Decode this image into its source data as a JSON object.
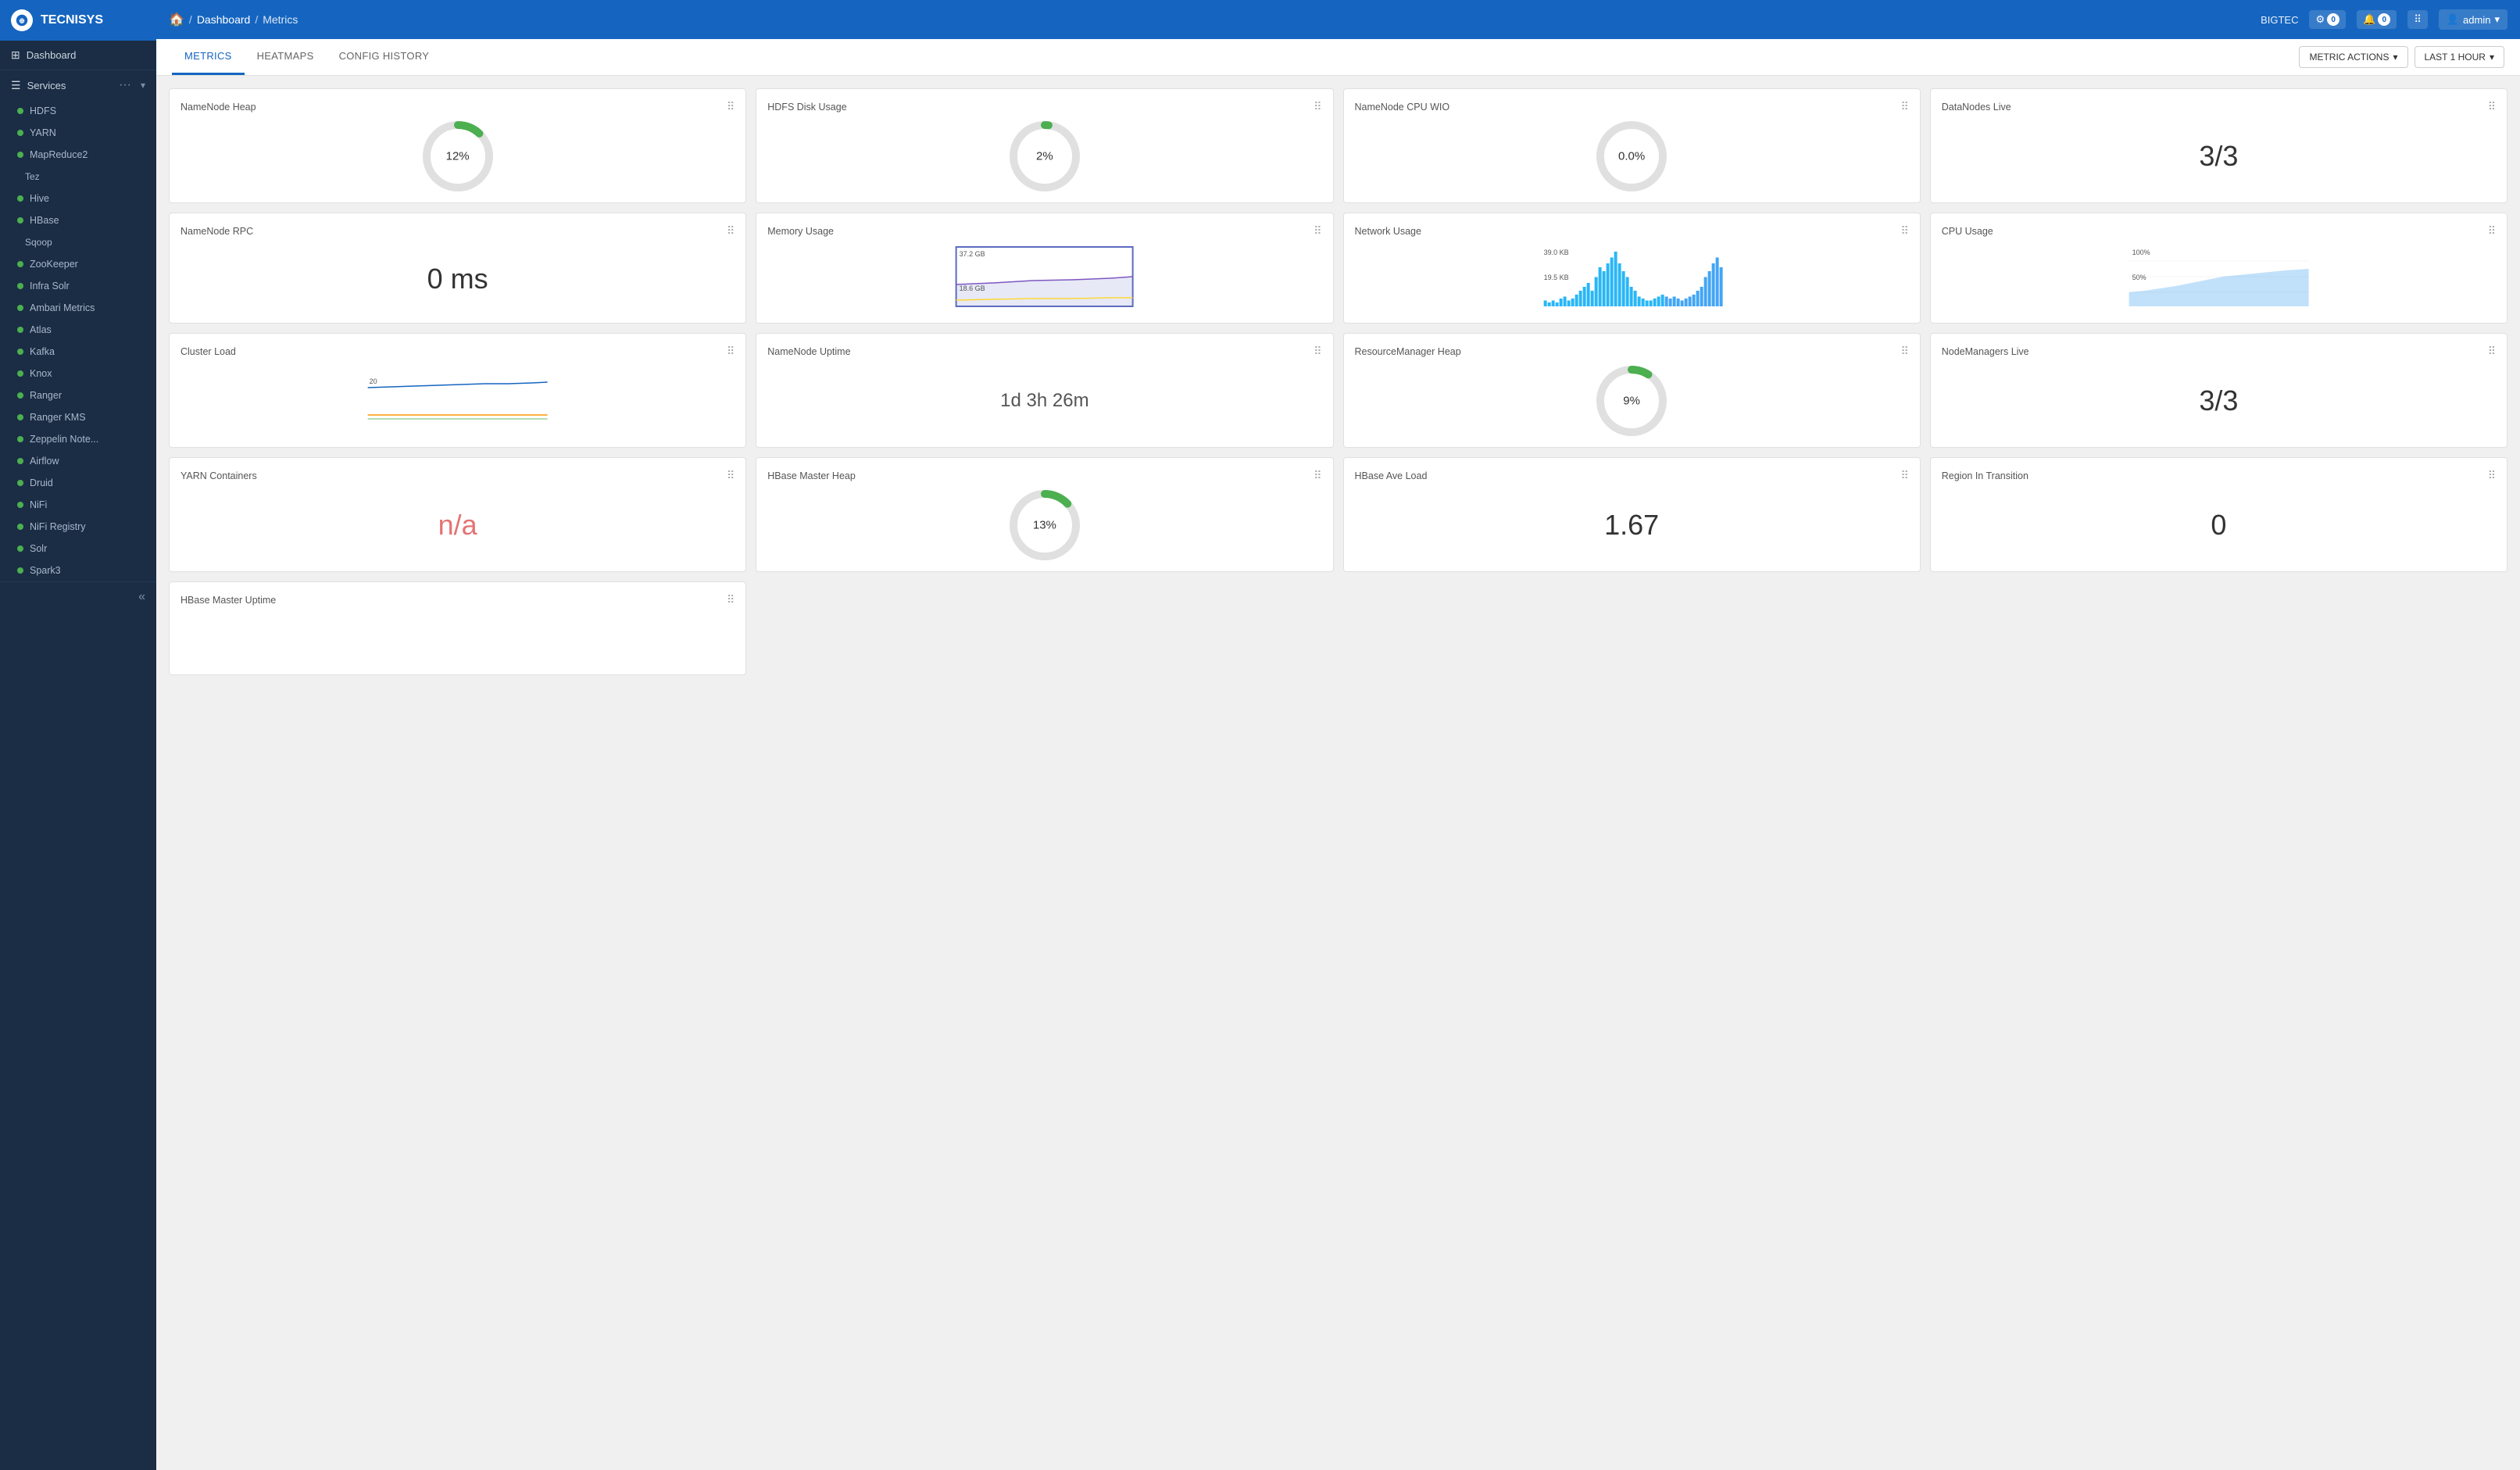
{
  "app": {
    "name": "TECNISYS",
    "cluster": "BIGTEC"
  },
  "topbar": {
    "home_icon": "🏠",
    "breadcrumb_sep": "/",
    "breadcrumb_page": "Dashboard",
    "breadcrumb_sub": "Metrics",
    "settings_badge": "0",
    "alerts_badge": "0",
    "admin_label": "admin"
  },
  "tabs": [
    {
      "id": "metrics",
      "label": "METRICS",
      "active": true
    },
    {
      "id": "heatmaps",
      "label": "HEATMAPS",
      "active": false
    },
    {
      "id": "config-history",
      "label": "CONFIG HISTORY",
      "active": false
    }
  ],
  "tab_actions": {
    "metric_actions": "METRIC ACTIONS",
    "time_range": "LAST 1 HOUR"
  },
  "sidebar": {
    "dashboard_label": "Dashboard",
    "services_label": "Services",
    "nav_items": [
      {
        "id": "hdfs",
        "label": "HDFS",
        "color": "#4caf50",
        "sub": false
      },
      {
        "id": "yarn",
        "label": "YARN",
        "color": "#4caf50",
        "sub": false
      },
      {
        "id": "mapreduce2",
        "label": "MapReduce2",
        "color": "#4caf50",
        "sub": false
      },
      {
        "id": "tez",
        "label": "Tez",
        "color": null,
        "sub": true
      },
      {
        "id": "hive",
        "label": "Hive",
        "color": "#4caf50",
        "sub": false
      },
      {
        "id": "hbase",
        "label": "HBase",
        "color": "#4caf50",
        "sub": false
      },
      {
        "id": "sqoop",
        "label": "Sqoop",
        "color": null,
        "sub": true
      },
      {
        "id": "zookeeper",
        "label": "ZooKeeper",
        "color": "#4caf50",
        "sub": false
      },
      {
        "id": "infra-solr",
        "label": "Infra Solr",
        "color": "#4caf50",
        "sub": false
      },
      {
        "id": "ambari-metrics",
        "label": "Ambari Metrics",
        "color": "#4caf50",
        "sub": false
      },
      {
        "id": "atlas",
        "label": "Atlas",
        "color": "#4caf50",
        "sub": false
      },
      {
        "id": "kafka",
        "label": "Kafka",
        "color": "#4caf50",
        "sub": false
      },
      {
        "id": "knox",
        "label": "Knox",
        "color": "#4caf50",
        "sub": false
      },
      {
        "id": "ranger",
        "label": "Ranger",
        "color": "#4caf50",
        "sub": false
      },
      {
        "id": "ranger-kms",
        "label": "Ranger KMS",
        "color": "#4caf50",
        "sub": false
      },
      {
        "id": "zeppelin",
        "label": "Zeppelin Note...",
        "color": "#4caf50",
        "sub": false
      },
      {
        "id": "airflow",
        "label": "Airflow",
        "color": "#4caf50",
        "sub": false
      },
      {
        "id": "druid",
        "label": "Druid",
        "color": "#4caf50",
        "sub": false
      },
      {
        "id": "nifi",
        "label": "NiFi",
        "color": "#4caf50",
        "sub": false
      },
      {
        "id": "nifi-registry",
        "label": "NiFi Registry",
        "color": "#4caf50",
        "sub": false
      },
      {
        "id": "solr",
        "label": "Solr",
        "color": "#4caf50",
        "sub": false
      },
      {
        "id": "spark3",
        "label": "Spark3",
        "color": "#4caf50",
        "sub": false
      }
    ]
  },
  "metrics": [
    {
      "id": "namenode-heap",
      "title": "NameNode Heap",
      "type": "donut",
      "value": "12%",
      "percent": 12,
      "color": "#4caf50",
      "track_color": "#e0e0e0"
    },
    {
      "id": "hdfs-disk-usage",
      "title": "HDFS Disk Usage",
      "type": "donut",
      "value": "2%",
      "percent": 2,
      "color": "#4caf50",
      "track_color": "#e0e0e0"
    },
    {
      "id": "namenode-cpu-wio",
      "title": "NameNode CPU WIO",
      "type": "donut",
      "value": "0.0%",
      "percent": 0,
      "color": "#e0e0e0",
      "track_color": "#e0e0e0"
    },
    {
      "id": "datanodes-live",
      "title": "DataNodes Live",
      "type": "number",
      "value": "3/3",
      "color": "#333"
    },
    {
      "id": "namenode-rpc",
      "title": "NameNode RPC",
      "type": "number",
      "value": "0 ms",
      "color": "#333"
    },
    {
      "id": "memory-usage",
      "title": "Memory Usage",
      "type": "line-chart",
      "labels": [
        "37.2 GB",
        "18.6 GB"
      ],
      "chart_type": "memory"
    },
    {
      "id": "network-usage",
      "title": "Network Usage",
      "type": "line-chart",
      "labels": [
        "39.0 KB",
        "19.5 KB"
      ],
      "chart_type": "network"
    },
    {
      "id": "cpu-usage",
      "title": "CPU Usage",
      "type": "line-chart",
      "labels": [
        "100%",
        "50%"
      ],
      "chart_type": "cpu"
    },
    {
      "id": "cluster-load",
      "title": "Cluster Load",
      "type": "line-chart",
      "labels": [
        "20"
      ],
      "chart_type": "cluster-load"
    },
    {
      "id": "namenode-uptime",
      "title": "NameNode Uptime",
      "type": "time",
      "value": "1d 3h 26m",
      "color": "#555"
    },
    {
      "id": "resourcemanager-heap",
      "title": "ResourceManager Heap",
      "type": "donut",
      "value": "9%",
      "percent": 9,
      "color": "#4caf50",
      "track_color": "#e0e0e0"
    },
    {
      "id": "nodemanagers-live",
      "title": "NodeManagers Live",
      "type": "number",
      "value": "3/3",
      "color": "#333"
    },
    {
      "id": "yarn-containers",
      "title": "YARN Containers",
      "type": "number",
      "value": "n/a",
      "color": "#e57373"
    },
    {
      "id": "hbase-master-heap",
      "title": "HBase Master Heap",
      "type": "donut",
      "value": "13%",
      "percent": 13,
      "color": "#4caf50",
      "track_color": "#e0e0e0"
    },
    {
      "id": "hbase-ave-load",
      "title": "HBase Ave Load",
      "type": "number",
      "value": "1.67",
      "color": "#333"
    },
    {
      "id": "region-in-transition",
      "title": "Region In Transition",
      "type": "number",
      "value": "0",
      "color": "#333"
    },
    {
      "id": "hbase-master-uptime",
      "title": "HBase Master Uptime",
      "type": "partial",
      "value": ""
    }
  ]
}
